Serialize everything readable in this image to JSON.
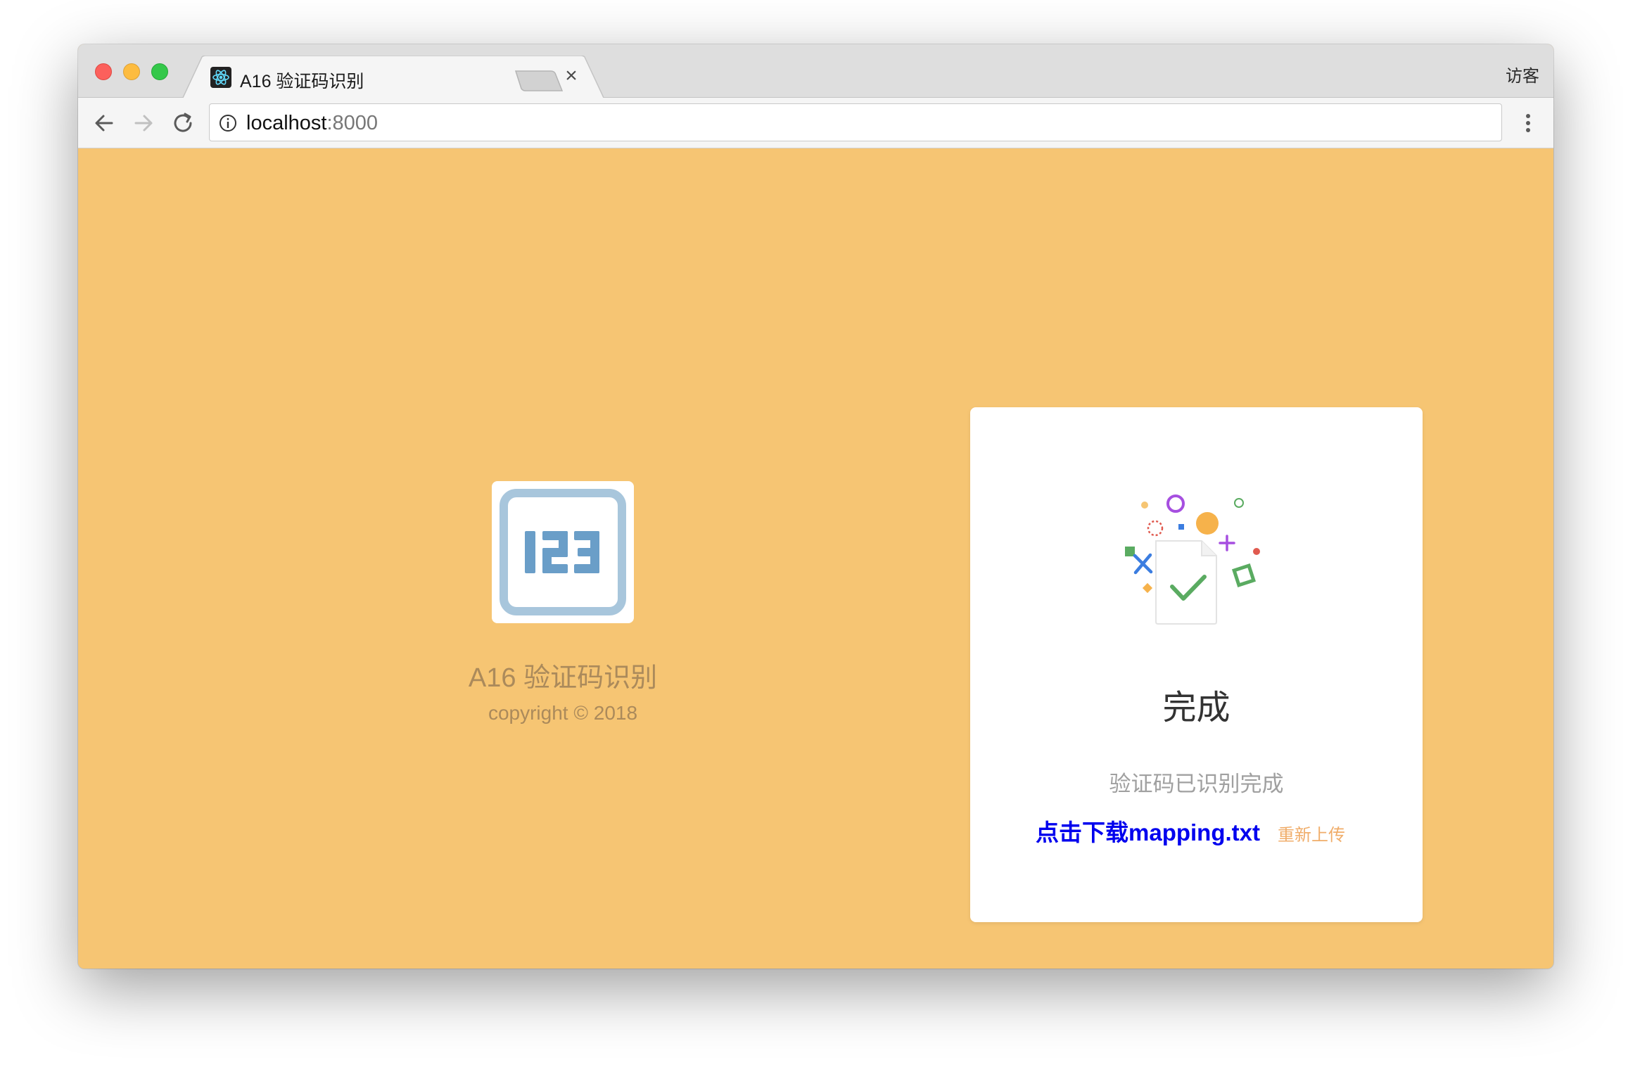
{
  "browser": {
    "tab_title": "A16 验证码识别",
    "tab_close": "×",
    "profile_label": "访客",
    "url_host": "localhost",
    "url_port": ":8000"
  },
  "app": {
    "logo_text": "123",
    "title": "A16 验证码识别",
    "copyright": "copyright © 2018"
  },
  "result": {
    "title": "完成",
    "description": "验证码已识别完成",
    "download_link": "点击下载mapping.txt",
    "reupload_link": "重新上传"
  },
  "colors": {
    "page_background": "#f6c573",
    "card_background": "#ffffff",
    "link": "#0000ee",
    "secondary_link": "#f0ad6a",
    "brand_text": "#ab8a5b",
    "logo_blue": "#6a9ec8",
    "check_green": "#5aab61"
  },
  "icons": {
    "back": "arrow-left-icon",
    "forward": "arrow-right-icon",
    "reload": "reload-icon",
    "info": "info-icon",
    "menu": "kebab-menu-icon",
    "favicon": "react-atom-icon",
    "success": "document-check-icon"
  }
}
